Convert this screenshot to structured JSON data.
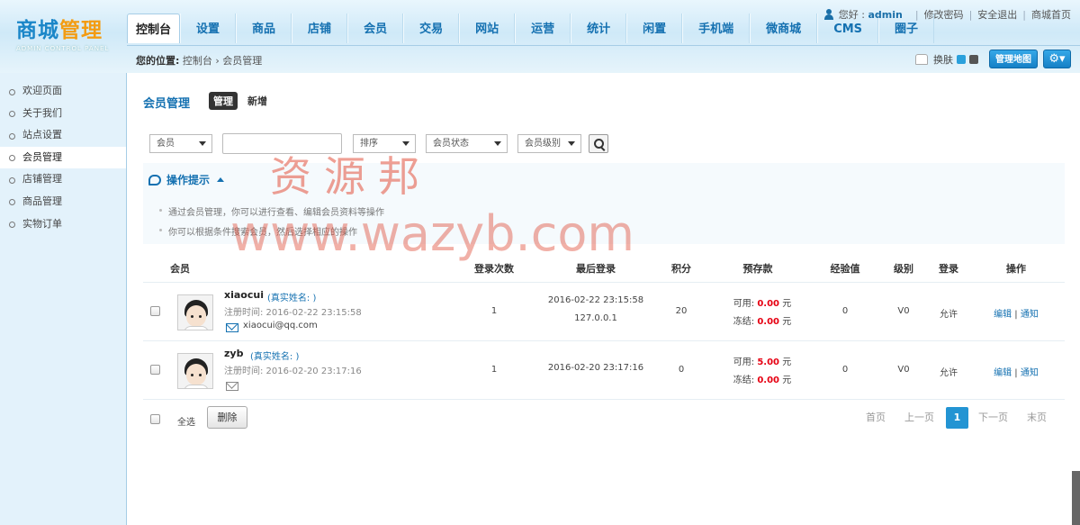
{
  "logo": {
    "title_a": "商城",
    "title_b": "管理",
    "subtitle": "ADMIN CONTROL PANEL"
  },
  "nav": [
    "控制台",
    "设置",
    "商品",
    "店铺",
    "会员",
    "交易",
    "网站",
    "运营",
    "统计",
    "闲置",
    "手机端",
    "微商城",
    "CMS",
    "圈子"
  ],
  "user": {
    "greeting": "您好 :",
    "name": "admin",
    "links": [
      "修改密码",
      "安全退出",
      "商城首页"
    ]
  },
  "crumb": {
    "label": "您的位置:",
    "path": "控制台 ›  会员管理"
  },
  "tools": {
    "skin": "换肤",
    "map": "管理地图",
    "swatches": [
      "#2aa0dc",
      "#555555"
    ]
  },
  "sidebar": [
    "欢迎页面",
    "关于我们",
    "站点设置",
    "会员管理",
    "店铺管理",
    "商品管理",
    "实物订单"
  ],
  "page": {
    "title": "会员管理",
    "tab_manage": "管理",
    "tab_add": "新增"
  },
  "filters": {
    "member": "会员",
    "search_value": "",
    "sort": "排序",
    "status": "会员状态",
    "level": "会员级别"
  },
  "tips": {
    "title": "操作提示",
    "items": [
      "通过会员管理，你可以进行查看、编辑会员资料等操作",
      "你可以根据条件搜索会员，然后选择相应的操作"
    ]
  },
  "columns": [
    "会员",
    "登录次数",
    "最后登录",
    "积分",
    "预存款",
    "经验值",
    "级别",
    "登录",
    "操作"
  ],
  "rows": [
    {
      "username": "xiaocui",
      "realname": "(真实姓名: )",
      "reg": "注册时间: 2016-02-22 23:15:58",
      "email": "xiaocui@qq.com",
      "logins": "1",
      "last_time": "2016-02-22 23:15:58",
      "last_ip": "127.0.0.1",
      "points": "20",
      "avail_label": "可用:",
      "avail": "0.00",
      "frozen_label": "冻结:",
      "frozen": "0.00",
      "unit": "元",
      "exp": "0",
      "level": "V0",
      "allow": "允许",
      "edit": "编辑",
      "notify": "通知"
    },
    {
      "username": "zyb",
      "realname": "(真实姓名: )",
      "reg": "注册时间: 2016-02-20 23:17:16",
      "email": "",
      "logins": "1",
      "last_time": "2016-02-20 23:17:16",
      "last_ip": "",
      "points": "0",
      "avail_label": "可用:",
      "avail": "5.00",
      "frozen_label": "冻结:",
      "frozen": "0.00",
      "unit": "元",
      "exp": "0",
      "level": "V0",
      "allow": "允许",
      "edit": "编辑",
      "notify": "通知"
    }
  ],
  "footer": {
    "select_all": "全选",
    "delete": "删除",
    "first": "首页",
    "prev": "上一页",
    "current": "1",
    "next": "下一页",
    "last": "末页"
  },
  "watermark": {
    "cn": "资源邦",
    "url": "www.wazyb.com"
  }
}
